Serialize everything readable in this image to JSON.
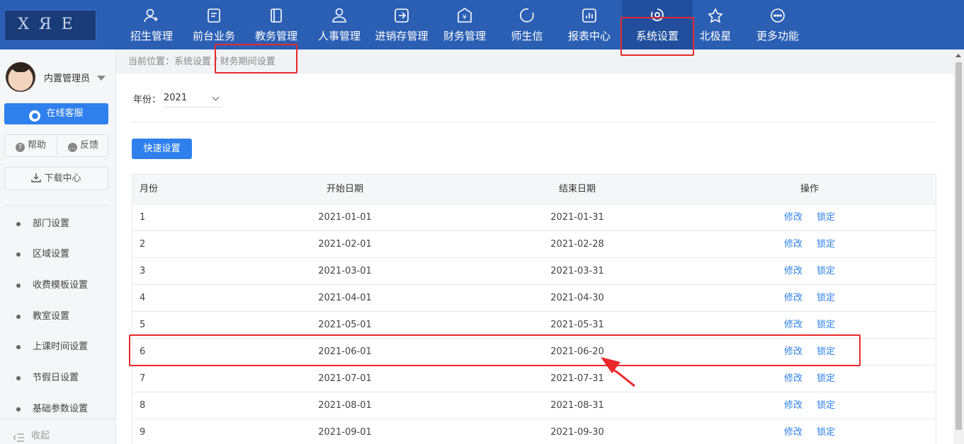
{
  "nav": {
    "logo_text": "ХЯЕ",
    "items": [
      {
        "label": "招生管理",
        "icon": "user-plus-icon"
      },
      {
        "label": "前台业务",
        "icon": "desk-icon"
      },
      {
        "label": "教务管理",
        "icon": "book-icon"
      },
      {
        "label": "人事管理",
        "icon": "person-icon"
      },
      {
        "label": "进销存管理",
        "icon": "arrow-box-icon"
      },
      {
        "label": "财务管理",
        "icon": "yuan-icon"
      },
      {
        "label": "师生信",
        "icon": "circle-icon"
      },
      {
        "label": "报表中心",
        "icon": "chart-icon"
      },
      {
        "label": "系统设置",
        "icon": "settings-icon"
      },
      {
        "label": "北极星",
        "icon": "star-icon"
      },
      {
        "label": "更多功能",
        "icon": "more-icon"
      }
    ],
    "active": "系统设置"
  },
  "sidebar": {
    "user_name": "内置管理员",
    "customer_service": "在线客服",
    "help": "帮助",
    "feedback": "反馈",
    "download": "下载中心",
    "menu": [
      "部门设置",
      "区域设置",
      "收费模板设置",
      "教室设置",
      "上课时间设置",
      "节假日设置",
      "基础参数设置"
    ],
    "collapse": "收起"
  },
  "breadcrumb": {
    "prefix": "当前位置：",
    "path": "系统设置 / 财务期间设置"
  },
  "filter": {
    "year_label": "年份：",
    "year_value": "2021"
  },
  "quick_setting": "快速设置",
  "table": {
    "headers": {
      "month": "月份",
      "start": "开始日期",
      "end": "结束日期",
      "op": "操作"
    },
    "rows": [
      {
        "month": "1",
        "start": "2021-01-01",
        "end": "2021-01-31"
      },
      {
        "month": "2",
        "start": "2021-02-01",
        "end": "2021-02-28"
      },
      {
        "month": "3",
        "start": "2021-03-01",
        "end": "2021-03-31"
      },
      {
        "month": "4",
        "start": "2021-04-01",
        "end": "2021-04-30"
      },
      {
        "month": "5",
        "start": "2021-05-01",
        "end": "2021-05-31"
      },
      {
        "month": "6",
        "start": "2021-06-01",
        "end": "2021-06-20"
      },
      {
        "month": "7",
        "start": "2021-07-01",
        "end": "2021-07-31"
      },
      {
        "month": "8",
        "start": "2021-08-01",
        "end": "2021-08-31"
      },
      {
        "month": "9",
        "start": "2021-09-01",
        "end": "2021-09-30"
      }
    ],
    "edit_label": "修改",
    "lock_label": "锁定"
  },
  "colors": {
    "nav_bg": "#2b5fb4",
    "accent": "#2f80ed",
    "highlight": "#e8282b"
  }
}
